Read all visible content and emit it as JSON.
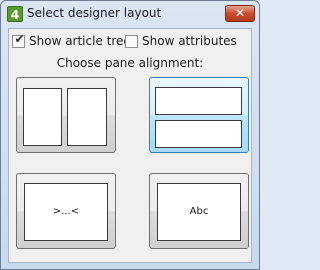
{
  "window": {
    "title": "Select designer layout",
    "icon_glyph": "4",
    "close_glyph": "✕"
  },
  "options": {
    "show_article_tree": {
      "label": "Show article tree",
      "checked": true,
      "check_glyph": "✔"
    },
    "show_attributes": {
      "label": "Show attributes",
      "checked": false
    }
  },
  "pane_alignment": {
    "caption": "Choose pane alignment:",
    "buttons": [
      {
        "name": "side-by-side",
        "selected": false
      },
      {
        "name": "stacked",
        "selected": true
      },
      {
        "name": "code",
        "label": ">...<",
        "selected": false
      },
      {
        "name": "text",
        "label": "Abc",
        "selected": false
      }
    ]
  },
  "colors": {
    "selected_border": "#3c7fb1",
    "close_button": "#c74f32",
    "app_icon": "#5b9a2c"
  }
}
